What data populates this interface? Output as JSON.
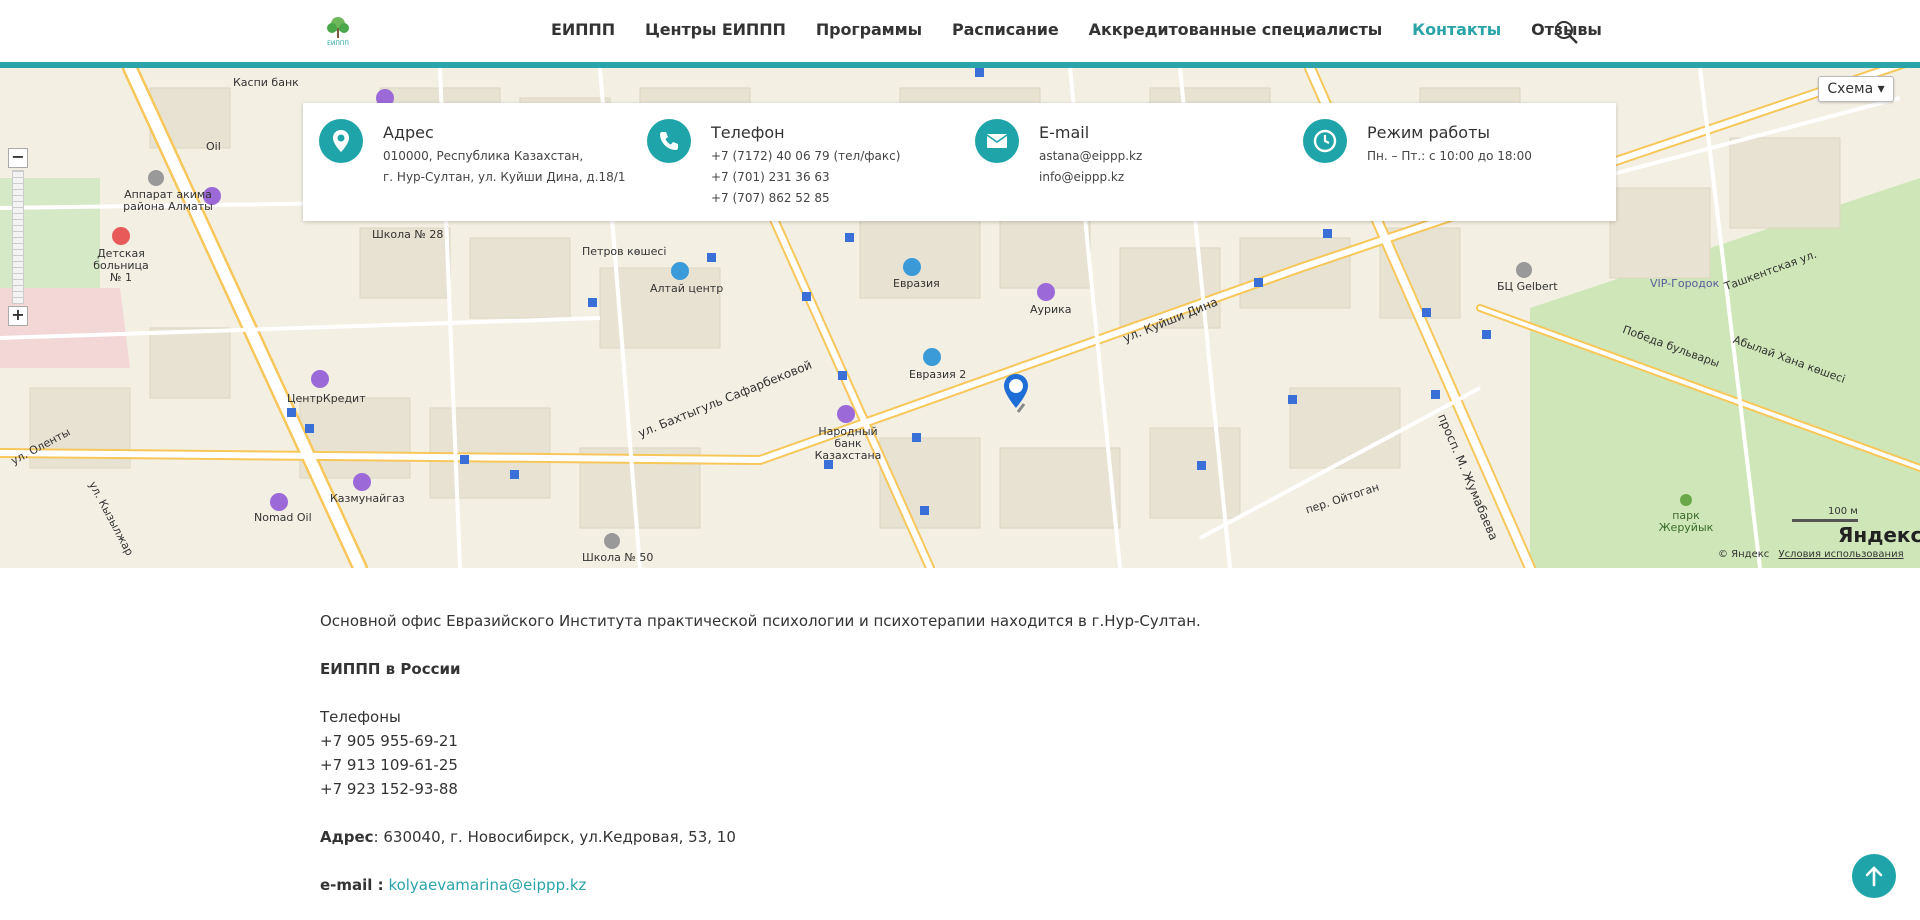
{
  "header": {
    "logo_text": "ЕИППП",
    "nav": [
      {
        "label": "ЕИППП",
        "active": false
      },
      {
        "label": "Центры ЕИППП",
        "active": false
      },
      {
        "label": "Программы",
        "active": false
      },
      {
        "label": "Расписание",
        "active": false
      },
      {
        "label": "Аккредитованные специалисты",
        "active": false
      },
      {
        "label": "Контакты",
        "active": true
      },
      {
        "label": "Отзывы",
        "active": false
      }
    ],
    "search_icon": "search-icon",
    "accent_color": "#2aa4a8"
  },
  "map": {
    "scheme_label": "Схема ▾",
    "scale_label": "100 м",
    "yandex_logo": "Яндекс",
    "copyright": "© Яндекс",
    "terms_link": "Условия использования",
    "zoom_in": "+",
    "zoom_out": "−",
    "labels": {
      "kaspi": "Каспи банк",
      "oil": "Oil",
      "akimat": "Аппарат акима района Алматы",
      "hospital": "Детская больница № 1",
      "school28": "Школа № 28",
      "petrov": "Петров көшесі",
      "altai": "Алтай центр",
      "evrazia": "Евразия",
      "aurika": "Аурика",
      "evrazia2": "Евразия 2",
      "narodny": "Народный банк Казахстана",
      "centrkredit": "ЦентрКредит",
      "kazmunaigaz": "Казмунайгаз",
      "nomad": "Nomad Oil",
      "school50": "Школа № 50",
      "gelbert": "БЦ Gelbert",
      "vip": "VIP-Городок",
      "park": "парк Жеруйык",
      "kuishi": "ул. Куйши Дина",
      "zhumabaeva": "просп. М. Жумабаева",
      "sapargali": "ул. Бахтыгуль Сафарбековой",
      "oitogan": "пер. Ойтоган",
      "pobeda": "Победа бульвары",
      "abylai": "Абылай Хана көшесі",
      "tashkent": "Ташкентская ул.",
      "olenty": "ул. Оленты",
      "kyzylzhar": "ул. Кызылжар"
    }
  },
  "contacts": {
    "address": {
      "icon": "location-pin-icon",
      "title": "Адрес",
      "lines": [
        "010000, Республика Казахстан,",
        "г. Нур-Султан, ул. Куйши Дина, д.18/1"
      ]
    },
    "phone": {
      "icon": "phone-icon",
      "title": "Телефон",
      "lines": [
        "+7 (7172) 40 06 79 (тел/факс)",
        "+7 (701) 231 36 63",
        "+7 (707) 862 52 85"
      ]
    },
    "email": {
      "icon": "envelope-icon",
      "title": "E-mail",
      "lines": [
        "astana@eippp.kz",
        "info@eippp.kz"
      ]
    },
    "hours": {
      "icon": "clock-icon",
      "title": "Режим работы",
      "lines": [
        "Пн. – Пт.: с 10:00 до 18:00"
      ]
    }
  },
  "content": {
    "intro": "Основной офис Евразийского Института практической психологии и психотерапии находится в г.Нур-Султан.",
    "russia_heading": "ЕИППП в России",
    "phones_label": "Телефоны",
    "phones": [
      "+7 905 955-69-21",
      "+7 913 109-61-25",
      "+7 923 152-93-88"
    ],
    "address_label": "Адрес",
    "address_value": ": 630040, г. Новосибирск, ул.Кедровая, 53, 10",
    "email_label": "e-mail :",
    "email_value": "kolyaevamarina@eippp.kz"
  }
}
